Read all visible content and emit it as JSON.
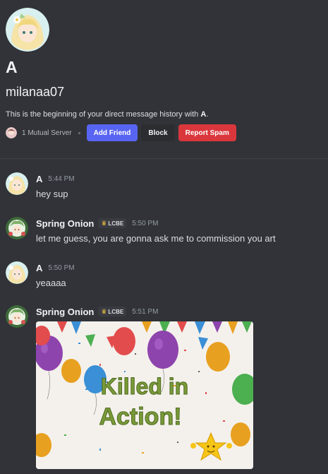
{
  "dm": {
    "display_name": "A",
    "username": "milanaa07",
    "beginning_prefix": "This is the beginning of your direct message history with ",
    "beginning_name": "A",
    "beginning_suffix": ".",
    "mutual_servers": "1 Mutual Server",
    "add_friend_label": "Add Friend",
    "block_label": "Block",
    "report_label": "Report Spam"
  },
  "colors": {
    "background": "#313338",
    "primary_button": "#5865f2",
    "danger_button": "#da373c",
    "secondary_button": "#2b2d31"
  },
  "messages": [
    {
      "author": "A",
      "time": "5:44 PM",
      "text": "hey sup"
    },
    {
      "author": "Spring Onion",
      "tag": "LCBE",
      "time": "5:50 PM",
      "text": "let me guess, you are gonna ask me to commission you art"
    },
    {
      "author": "A",
      "time": "5:50 PM",
      "text": "yeaaaa"
    },
    {
      "author": "Spring Onion",
      "tag": "LCBE",
      "time": "5:51 PM",
      "attachment_text_line1": "Killed in",
      "attachment_text_line2": "Action!"
    }
  ]
}
